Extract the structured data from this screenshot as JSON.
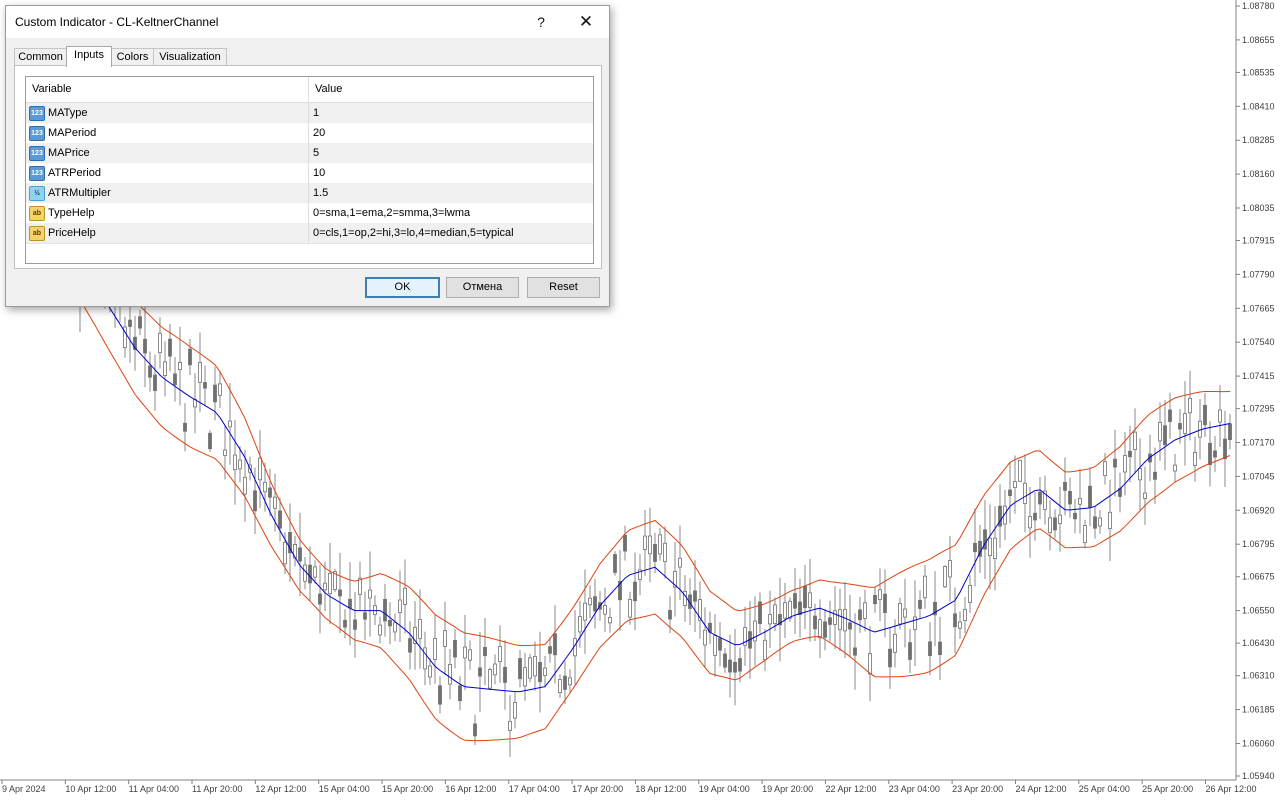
{
  "dialog": {
    "title": "Custom Indicator - CL-KeltnerChannel",
    "help_label": "?",
    "close_label": "✕",
    "tabs": [
      {
        "label": "Common"
      },
      {
        "label": "Inputs"
      },
      {
        "label": "Colors"
      },
      {
        "label": "Visualization"
      }
    ],
    "active_tab": "Inputs",
    "table": {
      "headers": {
        "variable": "Variable",
        "value": "Value"
      },
      "rows": [
        {
          "type_icon": "int-icon",
          "type_text": "123",
          "name": "MAType",
          "value": "1"
        },
        {
          "type_icon": "int-icon",
          "type_text": "123",
          "name": "MAPeriod",
          "value": "20"
        },
        {
          "type_icon": "int-icon",
          "type_text": "123",
          "name": "MAPrice",
          "value": "5"
        },
        {
          "type_icon": "int-icon",
          "type_text": "123",
          "name": "ATRPeriod",
          "value": "10"
        },
        {
          "type_icon": "double-icon",
          "type_text": "½",
          "name": "ATRMultipler",
          "value": "1.5"
        },
        {
          "type_icon": "string-icon",
          "type_text": "ab",
          "name": "TypeHelp",
          "value": "0=sma,1=ema,2=smma,3=lwma"
        },
        {
          "type_icon": "string-icon",
          "type_text": "ab",
          "name": "PriceHelp",
          "value": "0=cls,1=op,2=hi,3=lo,4=median,5=typical"
        }
      ]
    },
    "buttons": {
      "ok": "OK",
      "cancel": "Отмена",
      "reset": "Reset"
    }
  },
  "chart": {
    "price_axis_labels": [
      "1.08780",
      "1.08655",
      "1.08535",
      "1.08410",
      "1.08285",
      "1.08160",
      "1.08035",
      "1.07915",
      "1.07790",
      "1.07665",
      "1.07540",
      "1.07415",
      "1.07295",
      "1.07170",
      "1.07045",
      "1.06920",
      "1.06795",
      "1.06675",
      "1.06550",
      "1.06430",
      "1.06310",
      "1.06185",
      "1.06060",
      "1.05940"
    ],
    "time_axis_labels": [
      "9 Apr 2024",
      "10 Apr 12:00",
      "11 Apr 04:00",
      "11 Apr 20:00",
      "12 Apr 12:00",
      "15 Apr 04:00",
      "15 Apr 20:00",
      "16 Apr 12:00",
      "17 Apr 04:00",
      "17 Apr 20:00",
      "18 Apr 12:00",
      "19 Apr 04:00",
      "19 Apr 20:00",
      "22 Apr 12:00",
      "23 Apr 04:00",
      "23 Apr 20:00",
      "24 Apr 12:00",
      "25 Apr 04:00",
      "25 Apr 20:00",
      "26 Apr 12:00"
    ],
    "colors": {
      "middle_line": "#0000cc",
      "band_lines": "#dd4411",
      "candles": "#707070",
      "grid": "#c8c8c8"
    },
    "midline_trace": [
      1.0785,
      1.0768,
      1.0752,
      1.0741,
      1.0734,
      1.0728,
      1.0712,
      1.069,
      1.0672,
      1.0661,
      1.0655,
      1.0655,
      1.0647,
      1.0634,
      1.0627,
      1.0626,
      1.0625,
      1.0627,
      1.0641,
      1.0657,
      1.0668,
      1.0671,
      1.0662,
      1.0647,
      1.0642,
      1.0647,
      1.0653,
      1.0656,
      1.0652,
      1.0647,
      1.065,
      1.0653,
      1.0659,
      1.0679,
      1.0694,
      1.07,
      1.0692,
      1.0693,
      1.07,
      1.0711,
      1.0718,
      1.0722,
      1.0724
    ],
    "band_width": 0.0018
  }
}
